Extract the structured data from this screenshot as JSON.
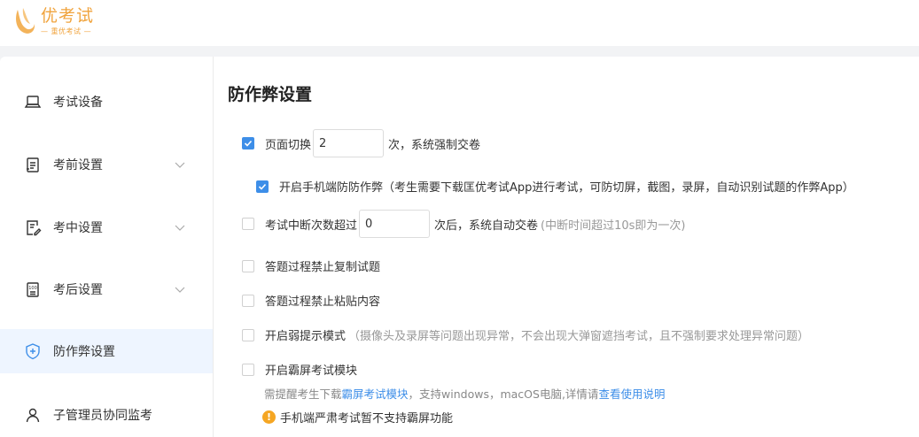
{
  "logo": {
    "title": "优考试",
    "subtitle": "— 重优考试 —"
  },
  "sidebar": {
    "items": [
      {
        "label": "考试设备",
        "icon": "laptop-icon",
        "has_chevron": false
      },
      {
        "label": "考前设置",
        "icon": "clipboard-icon",
        "has_chevron": true
      },
      {
        "label": "考中设置",
        "icon": "edit-doc-icon",
        "has_chevron": true
      },
      {
        "label": "考后设置",
        "icon": "score-doc-icon",
        "has_chevron": true
      },
      {
        "label": "防作弊设置",
        "icon": "shield-icon",
        "has_chevron": false,
        "active": true
      },
      {
        "label": "子管理员协同监考",
        "icon": "user-icon",
        "has_chevron": false
      }
    ]
  },
  "main": {
    "title": "防作弊设置",
    "page_switch": {
      "label": "页面切换",
      "value": "2",
      "suffix": "次，系统强制交卷",
      "checked": true
    },
    "mobile_anticheat": {
      "label": "开启手机端防防作弊（考生需要下载匡优考试App进行考试，可防切屏，截图，录屏，自动识别试题的作弊App）",
      "checked": true
    },
    "interrupt": {
      "label": "考试中断次数超过",
      "value": "0",
      "suffix": "次后，系统自动交卷",
      "hint": "(中断时间超过10s即为一次)",
      "checked": false
    },
    "no_copy": {
      "label": "答题过程禁止复制试题",
      "checked": false
    },
    "no_paste": {
      "label": "答题过程禁止粘贴内容",
      "checked": false
    },
    "weak_prompt": {
      "label": "开启弱提示模式",
      "hint": "（摄像头及录屏等问题出现异常，不会出现大弹窗遮挡考试，且不强制要求处理异常问题）",
      "checked": false
    },
    "lockscreen": {
      "label": "开启霸屏考试模块",
      "checked": false,
      "note_prefix": "需提醒考生下载",
      "note_link1": "霸屏考试模块",
      "note_middle": "，支持windows，macOS电脑,详情请",
      "note_link2": "查看使用说明",
      "warning": "手机端严肃考试暂不支持霸屏功能"
    }
  },
  "colors": {
    "accent": "#3d8ee8",
    "brand": "#f0a33c",
    "warning": "#f5a623"
  }
}
